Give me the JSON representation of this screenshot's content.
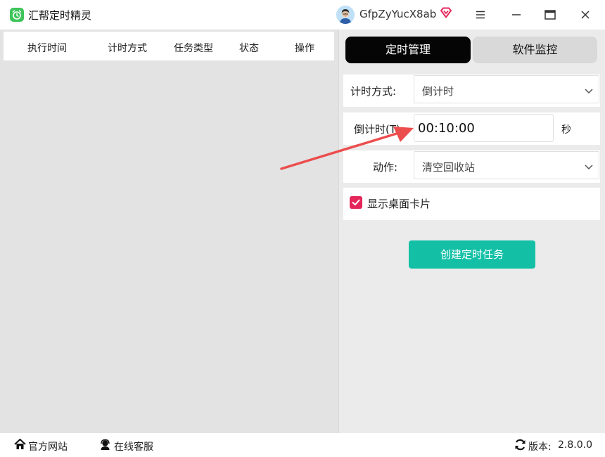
{
  "titlebar": {
    "app_title": "汇帮定时精灵",
    "username": "GfpZyYucX8ab",
    "icons": {
      "logo": "alarm-clock-icon",
      "avatar": "user-avatar",
      "vip": "diamond-vip-icon",
      "menu": "hamburger-menu-icon",
      "maximize": "maximize-icon",
      "close": "close-icon"
    }
  },
  "task_table": {
    "columns": [
      "执行时间",
      "计时方式",
      "任务类型",
      "状态",
      "操作"
    ],
    "rows": []
  },
  "tabs": [
    {
      "label": "定时管理",
      "active": true
    },
    {
      "label": "软件监控",
      "active": false
    }
  ],
  "form": {
    "timing_mode": {
      "label": "计时方式:",
      "value": "倒计时"
    },
    "countdown": {
      "label": "倒计时(T):",
      "value": "00:10:00",
      "unit": "秒"
    },
    "action": {
      "label": "动作:",
      "value": "清空回收站"
    },
    "show_card": {
      "label": "显示桌面卡片",
      "checked": true
    },
    "create_button": "创建定时任务"
  },
  "bottombar": {
    "website": "官方网站",
    "support": "在线客服",
    "version_label": "版本:",
    "version_value": "2.8.0.0"
  },
  "colors": {
    "accent_teal": "#13c0a6",
    "checkbox_pink": "#e5265b",
    "tab_active_bg": "#050505",
    "arrow_red": "#ec4d4d",
    "logo_green": "#3dc45a"
  }
}
